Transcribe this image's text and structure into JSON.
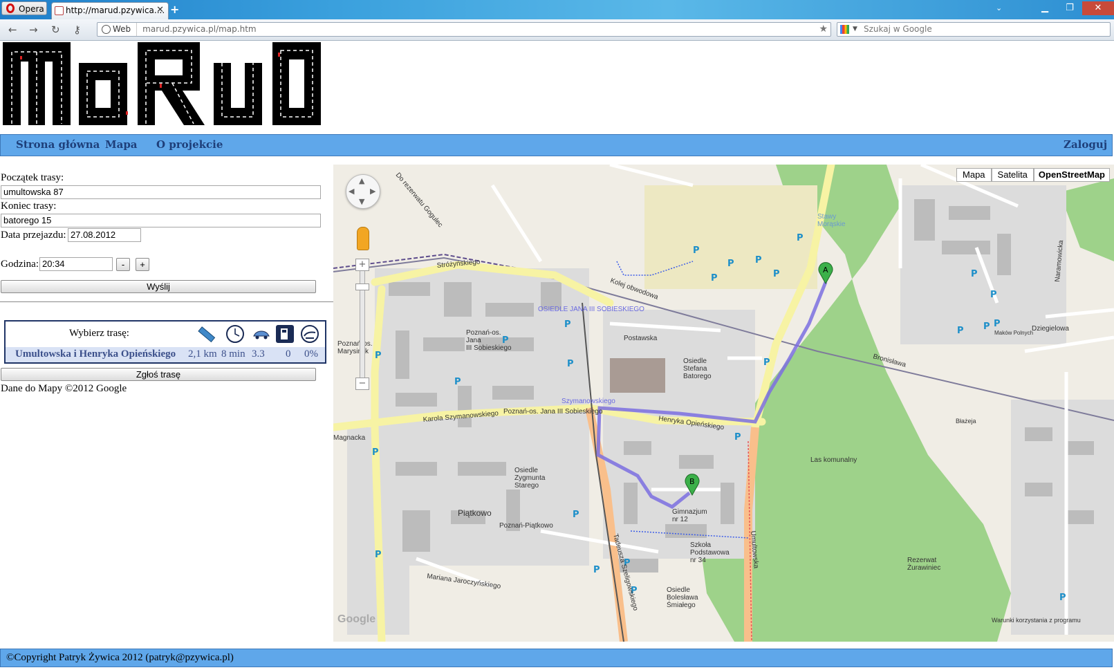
{
  "browser": {
    "menu_label": "Opera",
    "tab_title": "http://marud.pzywica....",
    "new_tab": "+",
    "address_prefix": "Web",
    "address": "marud.pzywica.pl/map.htm",
    "search_placeholder": "Szukaj w Google"
  },
  "site": {
    "logo_text": "MaRuD"
  },
  "nav": {
    "home": "Strona główna",
    "map": "Mapa",
    "about": "O projekcie",
    "login": "Zaloguj"
  },
  "form": {
    "start_label": "Początek trasy:",
    "start_value": "umultowska 87",
    "end_label": "Koniec trasy:",
    "end_value": "batorego 15",
    "date_label": "Data przejazdu:",
    "date_value": "27.08.2012",
    "time_label": "Godzina:",
    "time_value": "20:34",
    "minus_label": "-",
    "plus_label": "+",
    "submit_label": "Wyślij"
  },
  "routes": {
    "header": "Wybierz trasę:",
    "icons": [
      "ruler-icon",
      "clock-icon",
      "car-traffic-icon",
      "fuel-pump-icon",
      "emission-icon"
    ],
    "rows": [
      {
        "name": "Umultowska i Henryka Opieńskiego",
        "distance": "2,1 km",
        "time": "8 min",
        "traffic": "3.3",
        "fuel": "0",
        "emission": "0%"
      }
    ]
  },
  "report_label": "Zgłoś trasę",
  "map_credit": "Dane do Mapy ©2012 Google",
  "map": {
    "types": [
      "Mapa",
      "Satelita",
      "OpenStreetMap"
    ],
    "active_type": "OpenStreetMap",
    "marker_a": "A",
    "marker_b": "B",
    "zoom_in": "+",
    "zoom_out": "−",
    "labels": {
      "osiedle_sobieskiego": "OSIEDLE JANA III SOBIESKIEGO",
      "poznan_sobieskiego": "Poznań-os.\nJana\nIII Sobieskiego",
      "postawska": "Postawska",
      "osiedle_batorego": "Osiedle\nStefana\nBatorego",
      "szymanowskiego": "Szymanowskiego",
      "karola_szymanowskiego": "Karola Szymanowskiego",
      "poznan_os_sobieskiego": "Poznań-os. Jana III Sobieskiego",
      "henryka_opienskiego": "Henryka Opieńskiego",
      "las_komunalny": "Las komunalny",
      "osiedle_zygmunta": "Osiedle\nZygmunta\nStarego",
      "piatkowo": "Piątkowo",
      "poznan_piatkowo": "Poznań-Piątkowo",
      "gimnazjum": "Gimnazjum\nnr 12",
      "szkola": "Szkoła\nPodstawowa\nnr 34",
      "osiedle_smialego": "Osiedle\nBolesława\nŚmiałego",
      "rezerwat": "Rezerwat\nŻurawiniec",
      "umultowska": "Umultowska",
      "szeligowskiego": "Tadeusza Szeligowskiego",
      "strozynskiego": "Stróżyńskiego",
      "stawy": "Stawy\nMorąskie",
      "mariana": "Mariana Jaroczyńskiego",
      "naramowicka": "Naramowicka",
      "do_rezerwatu": "Do rezerwatu Gogulec",
      "bronislawa": "Bronisława",
      "dziegielowa": "Dziegielowa",
      "makow": "Maków Polnych",
      "kolej": "Kolej obwodowa",
      "poznan_marysin": "Poznań-os.\nMarysińsk",
      "magnacka": "Magnacka",
      "blazeja": "Błażeja",
      "terms": "Warunki korzystania z programu",
      "google": "Google"
    }
  },
  "footer": "©Copyright Patryk Żywica 2012 (patryk@pzywica.pl)"
}
